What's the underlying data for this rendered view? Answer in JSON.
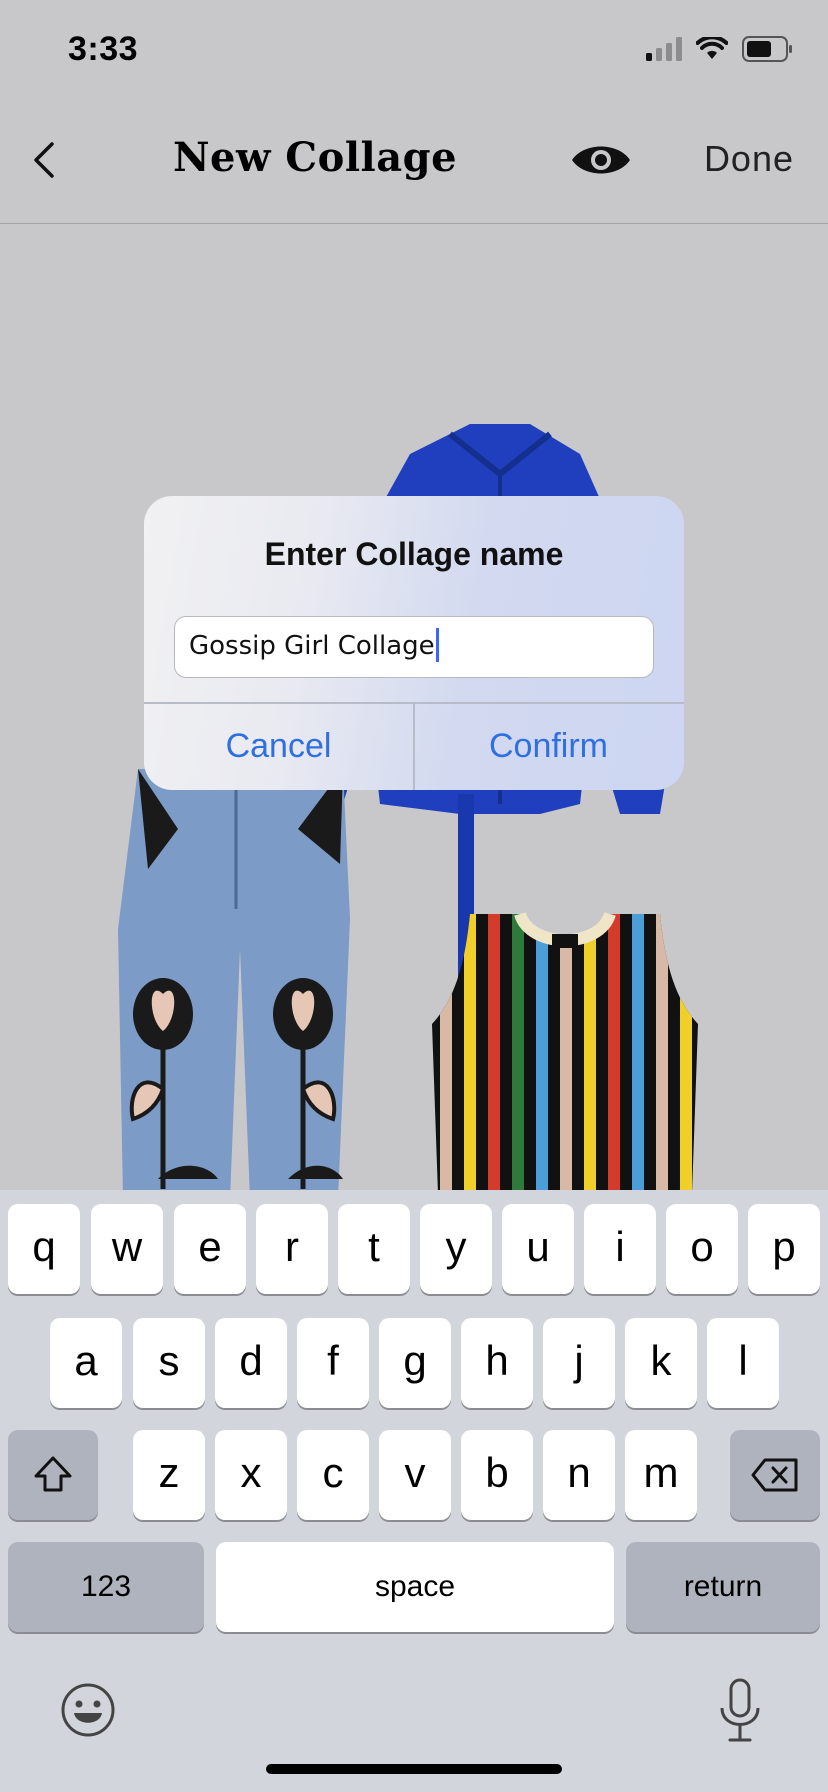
{
  "status_bar": {
    "time": "3:33",
    "signal_icon": "cellular-signal-icon",
    "wifi_icon": "wifi-icon",
    "battery_icon": "battery-icon"
  },
  "nav": {
    "back_icon": "chevron-left-icon",
    "title": "New Collage",
    "preview_icon": "eye-icon",
    "done_label": "Done"
  },
  "canvas": {
    "items": [
      "blue-shirt",
      "patched-jeans",
      "striped-knit-vest"
    ]
  },
  "dialog": {
    "title": "Enter Collage name",
    "input_value": "Gossip Girl Collage",
    "cancel_label": "Cancel",
    "confirm_label": "Confirm",
    "accent_color": "#2f6fe0"
  },
  "keyboard": {
    "row1": [
      "q",
      "w",
      "e",
      "r",
      "t",
      "y",
      "u",
      "i",
      "o",
      "p"
    ],
    "row2": [
      "a",
      "s",
      "d",
      "f",
      "g",
      "h",
      "j",
      "k",
      "l"
    ],
    "row3": [
      "z",
      "x",
      "c",
      "v",
      "b",
      "n",
      "m"
    ],
    "shift_icon": "shift-icon",
    "delete_icon": "backspace-icon",
    "numbers_label": "123",
    "space_label": "space",
    "return_label": "return",
    "emoji_icon": "emoji-icon",
    "mic_icon": "microphone-icon"
  }
}
